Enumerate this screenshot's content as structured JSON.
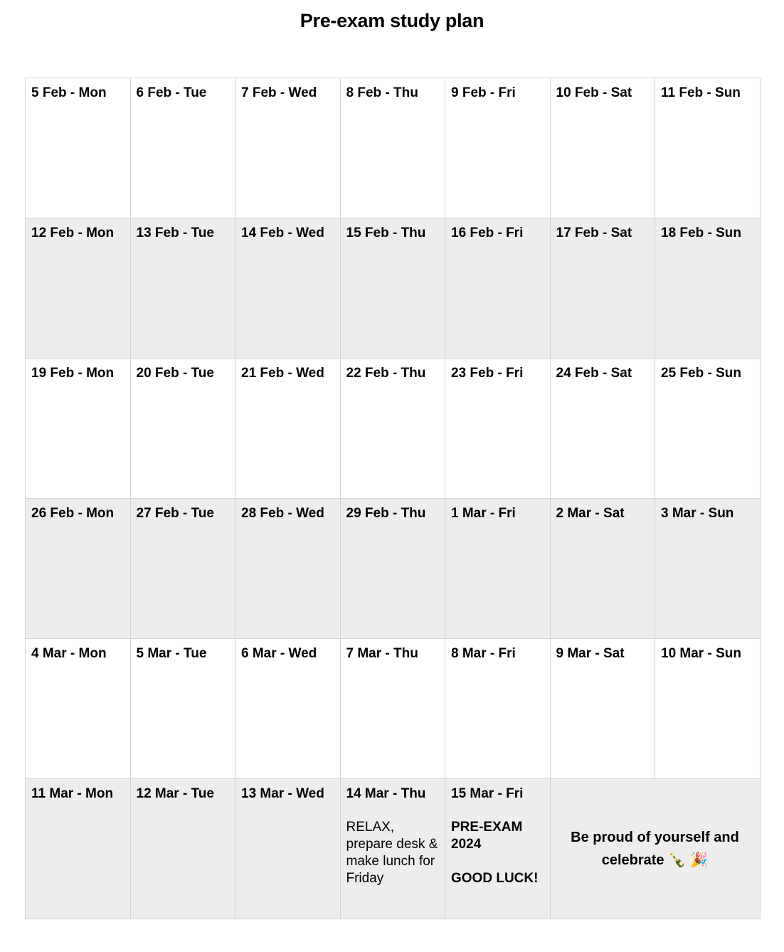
{
  "title": "Pre-exam study plan",
  "weeks": [
    {
      "days": [
        "5 Feb - Mon",
        "6 Feb - Tue",
        "7 Feb - Wed",
        "8 Feb - Thu",
        "9 Feb - Fri",
        "10 Feb - Sat",
        "11 Feb - Sun"
      ]
    },
    {
      "days": [
        "12 Feb - Mon",
        "13 Feb - Tue",
        "14 Feb - Wed",
        "15 Feb - Thu",
        "16 Feb - Fri",
        "17 Feb - Sat",
        "18 Feb - Sun"
      ]
    },
    {
      "days": [
        "19 Feb - Mon",
        "20 Feb - Tue",
        "21 Feb - Wed",
        "22 Feb - Thu",
        "23 Feb - Fri",
        "24 Feb - Sat",
        "25 Feb - Sun"
      ]
    },
    {
      "days": [
        "26 Feb - Mon",
        "27 Feb - Tue",
        "28 Feb - Wed",
        "29 Feb - Thu",
        "1 Mar - Fri",
        "2 Mar - Sat",
        "3 Mar - Sun"
      ]
    },
    {
      "days": [
        "4 Mar - Mon",
        "5 Mar - Tue",
        "6 Mar - Wed",
        "7 Mar - Thu",
        "8 Mar - Fri",
        "9 Mar - Sat",
        "10 Mar - Sun"
      ]
    },
    {
      "days": [
        "11 Mar - Mon",
        "12 Mar - Tue",
        "13 Mar - Wed",
        "14 Mar - Thu",
        "15 Mar - Fri"
      ]
    }
  ],
  "notes": {
    "thu_14_mar": "RELAX, prepare desk & make lunch for Friday",
    "fri_15_mar_line1": "PRE-EXAM 2024",
    "fri_15_mar_line2": "GOOD LUCK!",
    "celebrate_text": "Be proud of yourself and celebrate",
    "celebrate_emoji": "🍾 🎉"
  },
  "colors": {
    "shaded_row": "#ededed",
    "border": "#d4d4d4"
  }
}
